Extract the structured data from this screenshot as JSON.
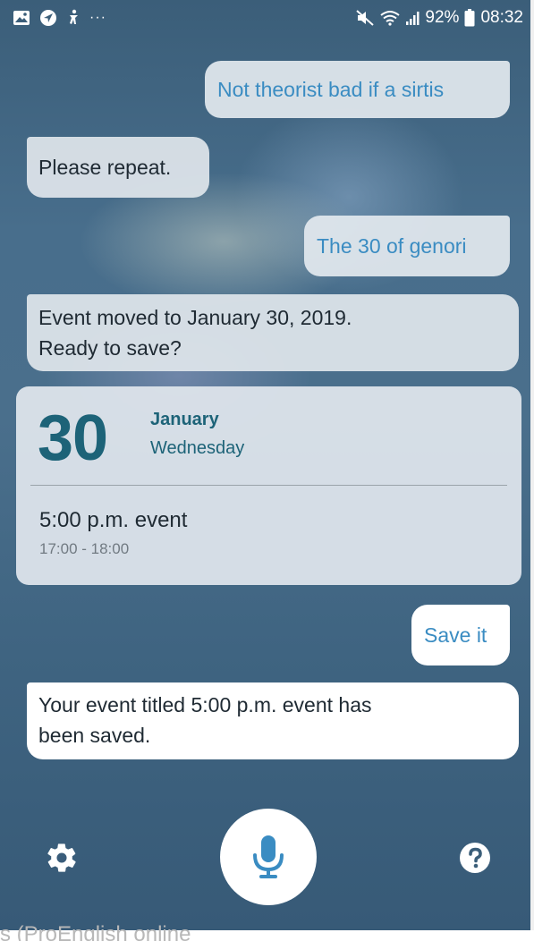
{
  "status_bar": {
    "left_icons": [
      "gallery-icon",
      "location-arrow-icon",
      "accessibility-icon"
    ],
    "more": "···",
    "battery_percent": "92%",
    "time": "08:32"
  },
  "conversation": {
    "user_msg_1": "Not theorist bad if a sirtis",
    "bot_msg_1": "Please repeat.",
    "user_msg_2": "The 30 of genori",
    "bot_msg_2_line1": "Event moved to January 30, 2019.",
    "bot_msg_2_line2": "Ready to save?",
    "user_msg_3": "Save it",
    "bot_msg_3_line1": "Your event titled 5:00 p.m. event has",
    "bot_msg_3_line2": "been saved."
  },
  "event_card": {
    "day": "30",
    "month": "January",
    "weekday": "Wednesday",
    "title": "5:00 p.m. event",
    "time_range": "17:00 - 18:00"
  },
  "controls": {
    "settings_icon": "gear-icon",
    "mic_icon": "microphone-icon",
    "help_icon": "question-mark-icon"
  },
  "colors": {
    "user_text": "#3a8cc2",
    "date_accent": "#1d6378",
    "background": "#466b89"
  },
  "watermark": "s (ProEnglish online"
}
